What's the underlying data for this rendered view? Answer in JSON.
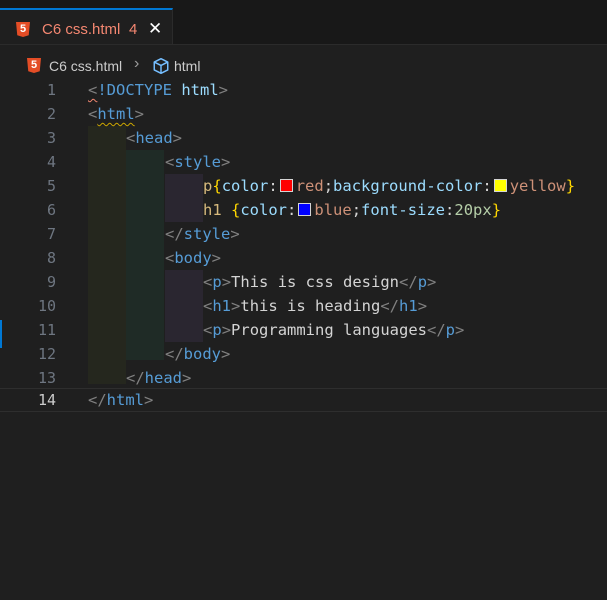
{
  "tab": {
    "label": "C6 css.html",
    "problem_count": "4",
    "close_glyph": "✕",
    "file_icon_text": "5"
  },
  "breadcrumb": {
    "file": "C6 css.html",
    "separator": "›",
    "symbol": "html"
  },
  "line_numbers": [
    "1",
    "2",
    "3",
    "4",
    "5",
    "6",
    "7",
    "8",
    "9",
    "10",
    "11",
    "12",
    "13",
    "14"
  ],
  "code": {
    "l1": {
      "open": "<",
      "decl": "!DOCTYPE",
      "attr": " html",
      "close": ">"
    },
    "l2": {
      "open": "<",
      "tag": "html",
      "close": ">"
    },
    "l3": {
      "open": "<",
      "tag": "head",
      "close": ">"
    },
    "l4": {
      "open": "<",
      "tag": "style",
      "close": ">"
    },
    "l5": {
      "sel": "p",
      "brace_open": "{",
      "prop1": "color",
      "colon1": ":",
      "val1": "red",
      "semi1": ";",
      "prop2": "background-color",
      "colon2": ":",
      "val2": "yellow",
      "brace_close": "}"
    },
    "l6": {
      "sel": "h1 ",
      "brace_open": "{",
      "prop1": "color",
      "colon1": ":",
      "val1": "blue",
      "semi1": ";",
      "prop2": "font-size",
      "colon2": ":",
      "val2": "20px",
      "brace_close": "}"
    },
    "l7": {
      "open": "</",
      "tag": "style",
      "close": ">"
    },
    "l8": {
      "open": "<",
      "tag": "body",
      "close": ">"
    },
    "l9": {
      "open": "<",
      "tag": "p",
      "close": ">",
      "text": "This is css design",
      "eopen": "</",
      "etag": "p",
      "eclose": ">"
    },
    "l10": {
      "open": "<",
      "tag": "h1",
      "close": ">",
      "text": "this is heading",
      "eopen": "</",
      "etag": "h1",
      "eclose": ">"
    },
    "l11": {
      "open": "<",
      "tag": "p",
      "close": ">",
      "text": "Programming languages",
      "eopen": "</",
      "etag": "p",
      "eclose": ">"
    },
    "l12": {
      "open": "</",
      "tag": "body",
      "close": ">"
    },
    "l13": {
      "open": "</",
      "tag": "head",
      "close": ">"
    },
    "l14": {
      "open": "</",
      "tag": "html",
      "close": ">"
    }
  },
  "swatches": {
    "red": "#ff0000",
    "yellow": "#ffff00",
    "blue": "#0000ff"
  },
  "colors": {
    "accent": "#0078d4",
    "error": "#f48771",
    "background": "#1f1f1f"
  }
}
